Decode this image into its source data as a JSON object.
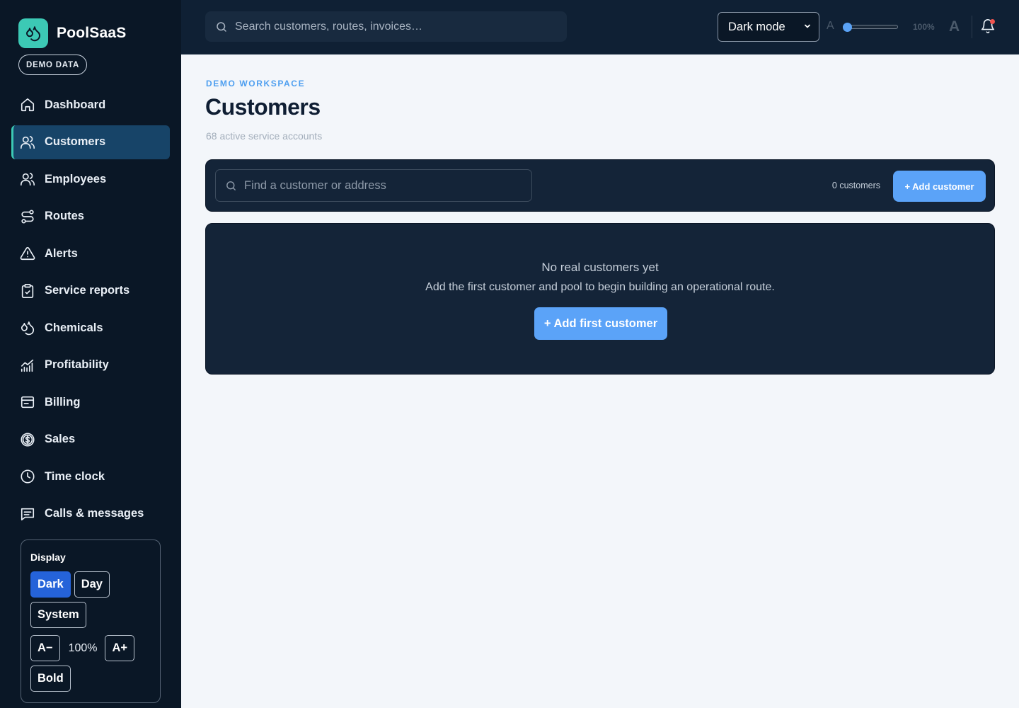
{
  "brand": {
    "name": "PoolSaaS",
    "badge": "DEMO DATA"
  },
  "sidebar": {
    "items": [
      {
        "label": "Dashboard",
        "icon": "home-icon",
        "active": false
      },
      {
        "label": "Customers",
        "icon": "users-icon",
        "active": true
      },
      {
        "label": "Employees",
        "icon": "users-icon",
        "active": false
      },
      {
        "label": "Routes",
        "icon": "route-icon",
        "active": false
      },
      {
        "label": "Alerts",
        "icon": "alert-triangle-icon",
        "active": false
      },
      {
        "label": "Service reports",
        "icon": "clipboard-check-icon",
        "active": false
      },
      {
        "label": "Chemicals",
        "icon": "droplets-icon",
        "active": false
      },
      {
        "label": "Profitability",
        "icon": "chart-icon",
        "active": false
      },
      {
        "label": "Billing",
        "icon": "billing-icon",
        "active": false
      },
      {
        "label": "Sales",
        "icon": "dollar-circle-icon",
        "active": false
      },
      {
        "label": "Time clock",
        "icon": "clock-icon",
        "active": false
      },
      {
        "label": "Calls & messages",
        "icon": "message-icon",
        "active": false
      }
    ],
    "display": {
      "title": "Display",
      "dark_label": "Dark",
      "day_label": "Day",
      "system_label": "System",
      "decrease_label": "A−",
      "font_size": "100%",
      "increase_label": "A+",
      "bold_label": "Bold",
      "active_theme": "Dark"
    }
  },
  "topbar": {
    "search_placeholder": "Search customers, routes, invoices…",
    "theme_select": "Dark mode",
    "theme_options": [
      "Dark mode"
    ],
    "font_small_label": "A",
    "font_large_label": "A",
    "zoom_label": "100%",
    "zoom_slider_fraction": 0.0,
    "notification_unread": true
  },
  "main": {
    "eyebrow": "DEMO WORKSPACE",
    "title": "Customers",
    "subtitle": "68 active service accounts",
    "find_placeholder": "Find a customer or address",
    "count_label": "0 customers",
    "add_button": "+ Add customer",
    "empty": {
      "title": "No real customers yet",
      "description": "Add the first customer and pool to begin building an operational route.",
      "button": "+ Add first customer"
    }
  },
  "colors": {
    "sidebar_bg": "#0a1726",
    "topbar_bg": "#0f2034",
    "page_bg": "#f3f6fa",
    "card_bg": "#142438",
    "accent_teal": "#3cc9b5",
    "accent_blue": "#5ba3f8",
    "active_nav_bg": "#174468",
    "active_toggle": "#2563d9",
    "notification_dot": "#f0544f"
  }
}
